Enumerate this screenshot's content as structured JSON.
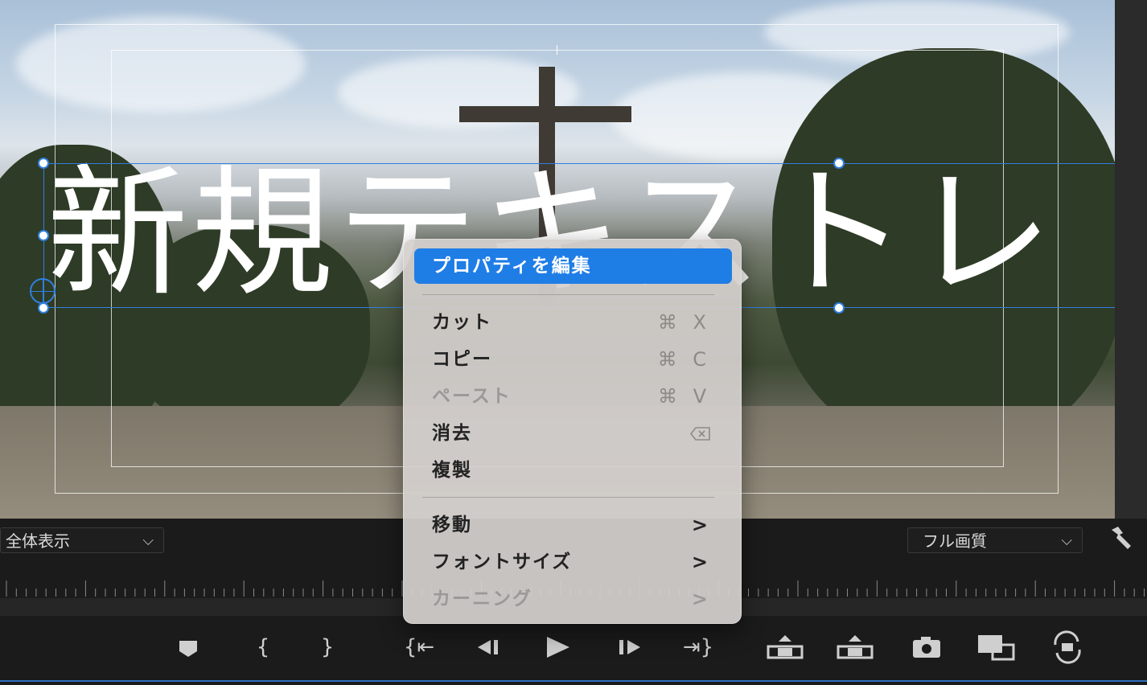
{
  "title_overlay": {
    "text": "新規テキストレ"
  },
  "context_menu": {
    "items": [
      {
        "label": "プロパティを編集",
        "shortcut": "",
        "highlighted": true,
        "disabled": false,
        "submenu": false
      },
      {
        "label": "カット",
        "shortcut": "⌘ X",
        "highlighted": false,
        "disabled": false,
        "submenu": false
      },
      {
        "label": "コピー",
        "shortcut": "⌘ C",
        "highlighted": false,
        "disabled": false,
        "submenu": false
      },
      {
        "label": "ペースト",
        "shortcut": "⌘ V",
        "highlighted": false,
        "disabled": true,
        "submenu": false
      },
      {
        "label": "消去",
        "shortcut_icon": "delete-key-icon",
        "highlighted": false,
        "disabled": false,
        "submenu": false
      },
      {
        "label": "複製",
        "shortcut": "",
        "highlighted": false,
        "disabled": false,
        "submenu": false
      },
      {
        "label": "移動",
        "submenu_arrow": ">",
        "highlighted": false,
        "disabled": false,
        "submenu": true
      },
      {
        "label": "フォントサイズ",
        "submenu_arrow": ">",
        "highlighted": false,
        "disabled": false,
        "submenu": true
      },
      {
        "label": "カーニング",
        "submenu_arrow": ">",
        "highlighted": false,
        "disabled": true,
        "submenu": true
      }
    ]
  },
  "monitor_controls": {
    "zoom_select": {
      "value": "全体表示",
      "icon": "chevron-down-icon"
    },
    "quality_select": {
      "value": "フル画質",
      "icon": "chevron-down-icon"
    },
    "settings_icon": "wrench-icon"
  },
  "transport_buttons": [
    {
      "name": "add-marker-icon",
      "glyph": "⯁"
    },
    {
      "name": "mark-in-icon",
      "glyph": "{"
    },
    {
      "name": "mark-out-icon",
      "glyph": "}"
    },
    {
      "name": "go-to-in-icon",
      "glyph": "{⇤"
    },
    {
      "name": "step-back-icon",
      "glyph": "◀❙"
    },
    {
      "name": "play-icon",
      "glyph": "▶"
    },
    {
      "name": "step-forward-icon",
      "glyph": "❙▶"
    },
    {
      "name": "go-to-out-icon",
      "glyph": "⇥}"
    },
    {
      "name": "lift-icon",
      "glyph": "⏏"
    },
    {
      "name": "extract-icon",
      "glyph": "⏏"
    },
    {
      "name": "export-frame-icon",
      "glyph": "📷"
    },
    {
      "name": "comparison-view-icon",
      "glyph": "▣"
    },
    {
      "name": "toggle-proxies-icon",
      "glyph": "⟳"
    }
  ],
  "colors": {
    "selection": "#2f7fe0",
    "menu_highlight": "#1f7de6",
    "menu_background": "#d4d0ce",
    "panel_background": "#1b1b1b"
  }
}
